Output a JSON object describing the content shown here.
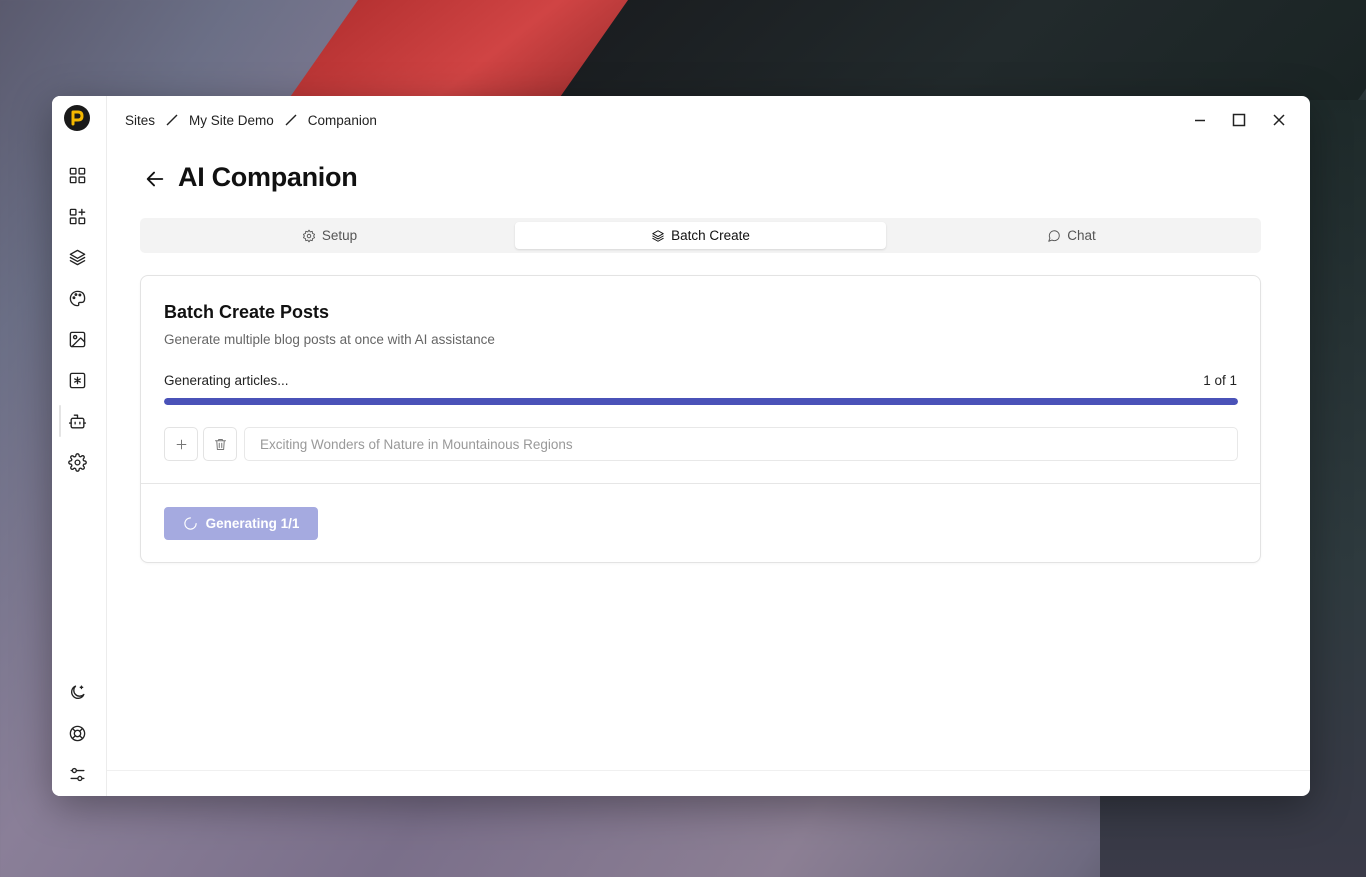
{
  "breadcrumb": {
    "items": [
      "Sites",
      "My Site Demo",
      "Companion"
    ]
  },
  "page": {
    "title": "AI Companion"
  },
  "tabs": [
    {
      "label": "Setup",
      "icon": "gear-icon",
      "active": false
    },
    {
      "label": "Batch Create",
      "icon": "layers-icon",
      "active": true
    },
    {
      "label": "Chat",
      "icon": "chat-bubble-icon",
      "active": false
    }
  ],
  "card": {
    "title": "Batch Create Posts",
    "description": "Generate multiple blog posts at once with AI assistance",
    "progress_label": "Generating articles...",
    "progress_count": "1 of 1",
    "progress_fraction": 1.0,
    "topic_value": "Exciting Wonders of Nature in Mountainous Regions",
    "generate_button": "Generating 1/1"
  },
  "sidebar": {
    "items": [
      "dashboard-icon",
      "widgets-icon",
      "layers-icon",
      "palette-icon",
      "image-icon",
      "asterisk-box-icon",
      "bot-icon",
      "gear-icon"
    ],
    "bottom_items": [
      "moon-icon",
      "lifebuoy-icon",
      "sliders-icon"
    ]
  },
  "colors": {
    "accent": "#4a52b8",
    "accent_disabled": "#a5aae0",
    "logo_yellow": "#f5b800"
  }
}
